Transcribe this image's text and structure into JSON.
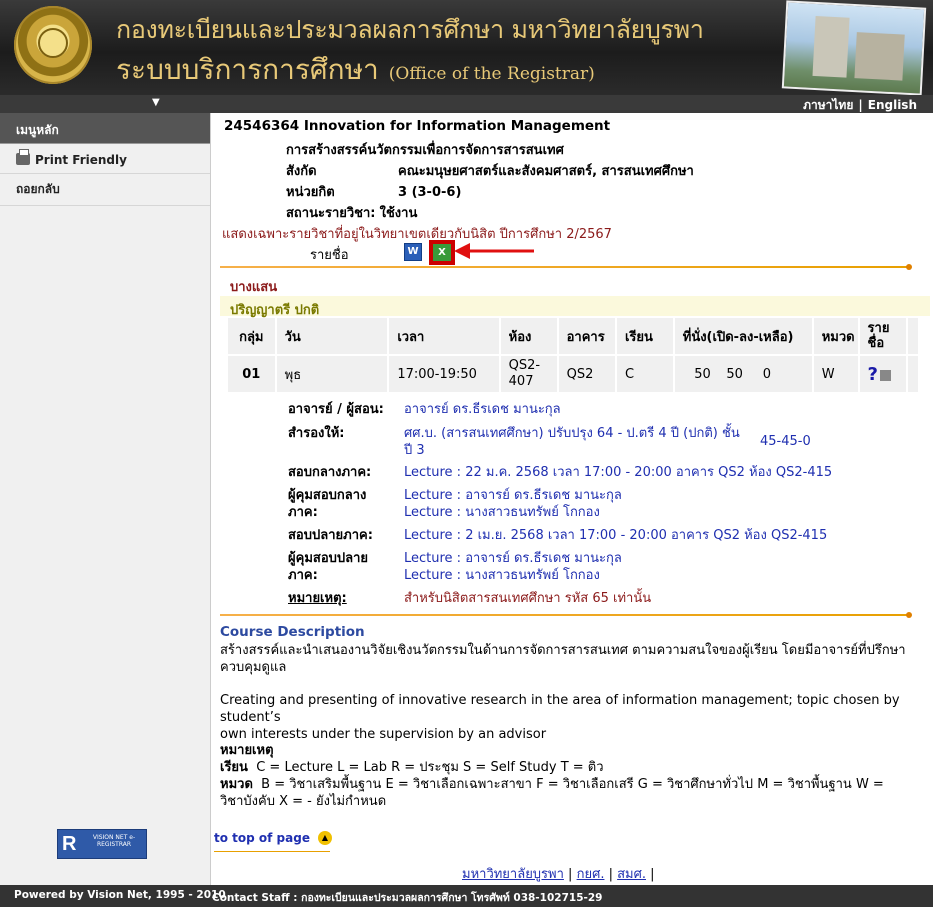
{
  "header": {
    "title_th": "กองทะเบียนและประมวลผลการศึกษา มหาวิทยาลัยบูรพา",
    "subtitle_th": "ระบบบริการการศึกษา",
    "subtitle_en": "(Office of the Registrar)",
    "lang_th": "ภาษาไทย",
    "lang_sep": "|",
    "lang_en": "English"
  },
  "sidebar": {
    "title": "เมนูหลัก",
    "items": [
      {
        "label": "Print Friendly",
        "icon": "printer-icon"
      },
      {
        "label": "ถอยกลับ"
      }
    ],
    "logo_text": "VISION NET e-REGISTRAR",
    "logo_letter": "R"
  },
  "course": {
    "code_name": "24546364 Innovation for Information Management",
    "name_th": "การสร้างสรรค์นวัตกรรมเพื่อการจัดการสารสนเทศ",
    "faculty_label": "สังกัด",
    "faculty_value": "คณะมนุษยศาสตร์และสังคมศาสตร์, สารสนเทศศึกษา",
    "credit_label": "หน่วยกิต",
    "credit_value": "3 (3-0-6)",
    "status_label": "สถานะรายวิชา:",
    "status_value": "ใช้งาน",
    "notice": "แสดงเฉพาะรายวิชาที่อยู่ในวิทยาเขตเดียวกับนิสิต ปีการศึกษา 2/2567",
    "roster_label": "รายชื่อ"
  },
  "campus": "บางแสน",
  "degree": "ปริญญาตรี ปกติ",
  "table": {
    "headers": [
      "กลุ่ม",
      "วัน",
      "เวลา",
      "ห้อง",
      "อาคาร",
      "เรียน",
      "ที่นั่ง(เปิด-ลง-เหลือ)",
      "หมวด",
      "ราย ชื่อ"
    ],
    "row": {
      "group": "01",
      "day": "พุธ",
      "time": "17:00-19:50",
      "room": "QS2-407",
      "building": "QS2",
      "type": "C",
      "seats_open": "50",
      "seats_enrolled": "50",
      "seats_left": "0",
      "category": "W",
      "roster_mark": "?"
    }
  },
  "details": {
    "instructor_label": "อาจารย์ / ผู้สอน:",
    "instructor": "อาจารย์ ดร.ธีรเดช มานะกุล",
    "reserved_label": "สำรองให้:",
    "reserved_1": "ศศ.บ. (สารสนเทศศึกษา) ปรับปรุง 64 - ป.ตรี 4 ปี (ปกติ) ชั้น",
    "reserved_2": "ปี 3",
    "reserved_seats": "45-45-0",
    "midterm_label": "สอบกลางภาค:",
    "midterm": "Lecture : 22 ม.ค. 2568 เวลา 17:00 - 20:00 อาคาร QS2 ห้อง QS2-415",
    "mid_proctor_label_1": "ผู้คุมสอบกลาง",
    "mid_proctor_label_2": "ภาค:",
    "mid_proctor_1": "Lecture : อาจารย์ ดร.ธีรเดช มานะกุล",
    "mid_proctor_2": "Lecture : นางสาวธนทรัพย์ โกกอง",
    "final_label": "สอบปลายภาค:",
    "final": "Lecture : 2 เม.ย. 2568 เวลา 17:00 - 20:00 อาคาร QS2 ห้อง QS2-415",
    "final_proctor_label_1": "ผู้คุมสอบปลาย",
    "final_proctor_label_2": "ภาค:",
    "final_proctor_1": "Lecture : อาจารย์ ดร.ธีรเดช มานะกุล",
    "final_proctor_2": "Lecture : นางสาวธนทรัพย์ โกกอง",
    "note_label": "หมายเหตุ:",
    "note": "สำหรับนิสิตสารสนเทศศึกษา รหัส 65 เท่านั้น"
  },
  "description": {
    "title": "Course Description",
    "th_1": "สร้างสรรค์และนำเสนองานวิจัยเชิงนวัตกรรมในด้านการจัดการสารสนเทศ ตามความสนใจของผู้เรียน โดยมีอาจารย์ที่ปรึกษา",
    "th_2": "ควบคุมดูแล",
    "en_1": "Creating and presenting of innovative research in the area of information management; topic chosen by student’s",
    "en_2": "own interests under the supervision by an advisor"
  },
  "legend": {
    "title": "หมายเหตุ",
    "study_label": "เรียน",
    "study_text": "C = Lecture  L = Lab  R = ประชุม  S = Self Study  T = ติว",
    "cat_label": "หมวด",
    "cat_text_1": "B = วิชาเสริมพื้นฐาน  E = วิชาเลือกเฉพาะสาขา  F = วิชาเลือกเสรี  G = วิชาศึกษาทั่วไป  M = วิชาพื้นฐาน  W =",
    "cat_text_2": "วิชาบังคับ  X = - ยังไม่กำหนด"
  },
  "top_link": "to top of page",
  "footer_links": [
    "มหาวิทยาลัยบูรพา",
    "กยศ.",
    "สมศ."
  ],
  "footer": {
    "left": "Powered by Vision Net, 1995 - 2010",
    "right": "Contact Staff : กองทะเบียนและประมวลผลการศึกษา โทรศัพท์ 038-102715-29"
  }
}
